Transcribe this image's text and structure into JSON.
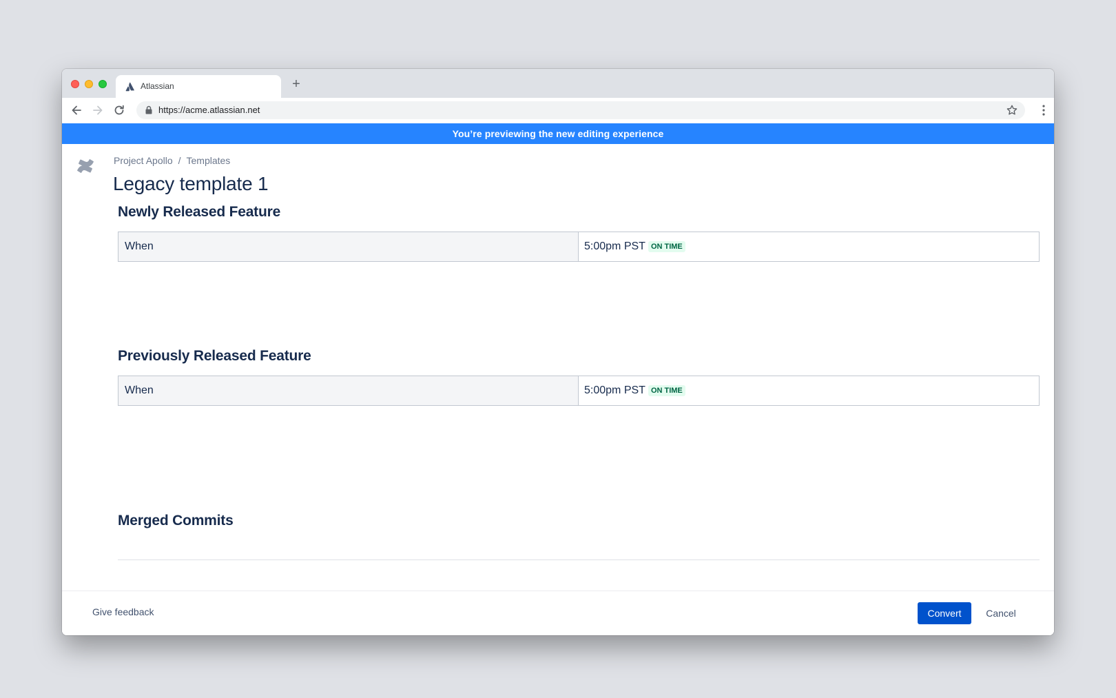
{
  "browser": {
    "tab_title": "Atlassian",
    "new_tab_symbol": "+",
    "url": "https://acme.atlassian.net",
    "icons": {
      "tab": "atlassian-logo-icon",
      "back": "arrow-left-icon",
      "forward": "arrow-right-icon",
      "reload": "reload-icon",
      "lock": "lock-icon",
      "bookmark": "star-icon",
      "menu": "kebab-menu-icon"
    }
  },
  "banner": {
    "text": "You’re previewing the new editing experience",
    "color": "#2684ff"
  },
  "page": {
    "breadcrumb": [
      "Project Apollo",
      "Templates"
    ],
    "breadcrumb_separator": "/",
    "title": "Legacy template 1",
    "sections": [
      {
        "heading": "Newly Released Feature",
        "table": {
          "label": "When",
          "value": "5:00pm PST",
          "status": "ON TIME"
        }
      },
      {
        "heading": "Previously Released Feature",
        "table": {
          "label": "When",
          "value": "5:00pm PST",
          "status": "ON TIME"
        }
      },
      {
        "heading": "Merged Commits"
      }
    ]
  },
  "footer": {
    "feedback": "Give feedback",
    "convert": "Convert",
    "cancel": "Cancel"
  },
  "colors": {
    "primary": "#0052cc",
    "text": "#172b4d",
    "lozenge_bg": "#e3fcef",
    "lozenge_text": "#006644"
  }
}
